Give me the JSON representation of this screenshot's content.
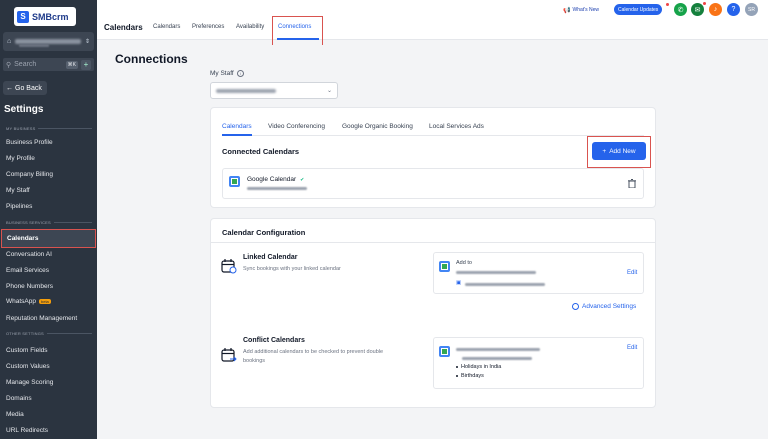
{
  "sidebar": {
    "logo_text": "SMBcrm",
    "search_placeholder": "Search",
    "search_shortcut": "⌘K",
    "go_back": "Go Back",
    "settings_title": "Settings",
    "sections": [
      {
        "label": "MY BUSINESS"
      },
      {
        "label": "BUSINESS SERVICES"
      },
      {
        "label": "OTHER SETTINGS"
      }
    ],
    "items": [
      {
        "label": "Business Profile"
      },
      {
        "label": "My Profile"
      },
      {
        "label": "Company Billing"
      },
      {
        "label": "My Staff"
      },
      {
        "label": "Pipelines"
      },
      {
        "label": "Calendars"
      },
      {
        "label": "Conversation AI"
      },
      {
        "label": "Email Services"
      },
      {
        "label": "Phone Numbers"
      },
      {
        "label": "WhatsApp"
      },
      {
        "label": "Reputation Management"
      },
      {
        "label": "Custom Fields"
      },
      {
        "label": "Custom Values"
      },
      {
        "label": "Manage Scoring"
      },
      {
        "label": "Domains"
      },
      {
        "label": "Media"
      },
      {
        "label": "URL Redirects"
      }
    ],
    "whatsapp_badge": "beta"
  },
  "header": {
    "title": "Calendars",
    "tabs": [
      {
        "label": "Calendars"
      },
      {
        "label": "Preferences"
      },
      {
        "label": "Availability"
      },
      {
        "label": "Connections"
      }
    ],
    "whats_new": "What's New",
    "calendar_updates": "Calendar Updates",
    "avatar_initials": "SR",
    "help_icon_text": "?"
  },
  "main": {
    "title": "Connections",
    "my_staff_label": "My Staff",
    "sub_tabs": [
      {
        "label": "Calendars"
      },
      {
        "label": "Video Conferencing"
      },
      {
        "label": "Google Organic Booking"
      },
      {
        "label": "Local Services Ads"
      }
    ],
    "connected_title": "Connected Calendars",
    "add_new": "Add New",
    "google_calendar": "Google Calendar",
    "config_title": "Calendar Configuration",
    "linked": {
      "title": "Linked Calendar",
      "desc": "Sync bookings with your linked calendar",
      "add_to": "Add to",
      "edit": "Edit"
    },
    "advanced_settings": "Advanced Settings",
    "conflict": {
      "title": "Conflict Calendars",
      "desc_line1": "Add additional calendars to be checked to prevent double",
      "desc_line2": "bookings",
      "edit": "Edit",
      "items": [
        "Holidays in India",
        "Birthdays"
      ]
    }
  },
  "colors": {
    "accent": "#2563eb",
    "sidebar_bg": "#2b3440",
    "highlight": "#d9534f"
  }
}
